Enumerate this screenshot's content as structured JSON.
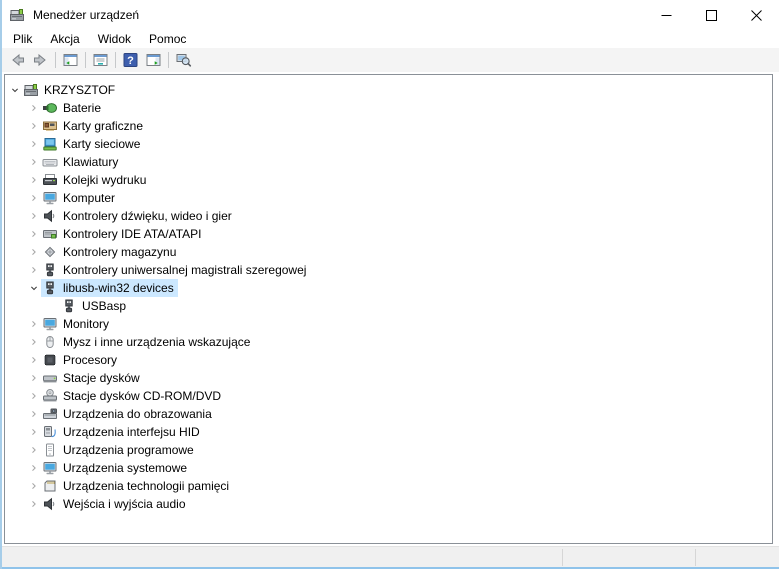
{
  "window": {
    "title": "Menedżer urządzeń",
    "app_icon": "device-manager-icon"
  },
  "menu": {
    "items": [
      {
        "label": "Plik"
      },
      {
        "label": "Akcja"
      },
      {
        "label": "Widok"
      },
      {
        "label": "Pomoc"
      }
    ]
  },
  "toolbar": {
    "help_glyph": "?",
    "buttons": [
      {
        "icon": "back-arrow-icon"
      },
      {
        "icon": "forward-arrow-icon"
      },
      {
        "icon": "console-tree-icon"
      },
      {
        "icon": "properties-icon"
      },
      {
        "icon": "help-icon"
      },
      {
        "icon": "action-pane-icon"
      },
      {
        "icon": "scan-hardware-icon"
      }
    ]
  },
  "tree": {
    "items": [
      {
        "label": "KRZYSZTOF",
        "icon": "computer-icon",
        "level": 0,
        "state": "expanded",
        "selected": false
      },
      {
        "label": "Baterie",
        "icon": "battery-icon",
        "level": 1,
        "state": "collapsed",
        "selected": false
      },
      {
        "label": "Karty graficzne",
        "icon": "display-adapter-icon",
        "level": 1,
        "state": "collapsed",
        "selected": false
      },
      {
        "label": "Karty sieciowe",
        "icon": "network-adapter-icon",
        "level": 1,
        "state": "collapsed",
        "selected": false
      },
      {
        "label": "Klawiatury",
        "icon": "keyboard-icon",
        "level": 1,
        "state": "collapsed",
        "selected": false
      },
      {
        "label": "Kolejki wydruku",
        "icon": "printer-icon",
        "level": 1,
        "state": "collapsed",
        "selected": false
      },
      {
        "label": "Komputer",
        "icon": "computer-monitor-icon",
        "level": 1,
        "state": "collapsed",
        "selected": false
      },
      {
        "label": "Kontrolery dźwięku, wideo i gier",
        "icon": "speaker-icon",
        "level": 1,
        "state": "collapsed",
        "selected": false
      },
      {
        "label": "Kontrolery IDE ATA/ATAPI",
        "icon": "ide-controller-icon",
        "level": 1,
        "state": "collapsed",
        "selected": false
      },
      {
        "label": "Kontrolery magazynu",
        "icon": "storage-controller-icon",
        "level": 1,
        "state": "collapsed",
        "selected": false
      },
      {
        "label": "Kontrolery uniwersalnej magistrali szeregowej",
        "icon": "usb-icon",
        "level": 1,
        "state": "collapsed",
        "selected": false
      },
      {
        "label": "libusb-win32 devices",
        "icon": "usb-icon",
        "level": 1,
        "state": "expanded",
        "selected": true
      },
      {
        "label": "USBasp",
        "icon": "usb-icon",
        "level": 2,
        "state": "leaf",
        "selected": false
      },
      {
        "label": "Monitory",
        "icon": "monitor-icon",
        "level": 1,
        "state": "collapsed",
        "selected": false
      },
      {
        "label": "Mysz i inne urządzenia wskazujące",
        "icon": "mouse-icon",
        "level": 1,
        "state": "collapsed",
        "selected": false
      },
      {
        "label": "Procesory",
        "icon": "processor-icon",
        "level": 1,
        "state": "collapsed",
        "selected": false
      },
      {
        "label": "Stacje dysków",
        "icon": "disk-drive-icon",
        "level": 1,
        "state": "collapsed",
        "selected": false
      },
      {
        "label": "Stacje dysków CD-ROM/DVD",
        "icon": "cdrom-icon",
        "level": 1,
        "state": "collapsed",
        "selected": false
      },
      {
        "label": "Urządzenia do obrazowania",
        "icon": "imaging-device-icon",
        "level": 1,
        "state": "collapsed",
        "selected": false
      },
      {
        "label": "Urządzenia interfejsu HID",
        "icon": "hid-device-icon",
        "level": 1,
        "state": "collapsed",
        "selected": false
      },
      {
        "label": "Urządzenia programowe",
        "icon": "software-device-icon",
        "level": 1,
        "state": "collapsed",
        "selected": false
      },
      {
        "label": "Urządzenia systemowe",
        "icon": "system-device-icon",
        "level": 1,
        "state": "collapsed",
        "selected": false
      },
      {
        "label": "Urządzenia technologii pamięci",
        "icon": "memory-device-icon",
        "level": 1,
        "state": "collapsed",
        "selected": false
      },
      {
        "label": "Wejścia i wyjścia audio",
        "icon": "audio-io-icon",
        "level": 1,
        "state": "collapsed",
        "selected": false
      }
    ]
  },
  "colors": {
    "selection_bg": "#cce8ff",
    "window_border_left": "#a6cde9",
    "window_border_bottom": "#8fc3ea",
    "toolbar_bg": "#f4f4f4",
    "statusbar_bg": "#f0f0f0",
    "panel_border": "#8a9097",
    "help_blue": "#3e5fae",
    "accent_green": "#1fa01f"
  }
}
